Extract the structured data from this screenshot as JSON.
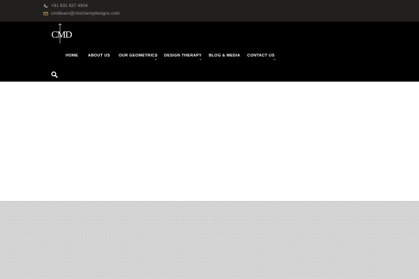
{
  "topbar": {
    "phone_icon": "phone-icon",
    "phone": "+91 931 837 4904",
    "email_icon": "envelope-icon",
    "email": "cmdteam@chizzlemydesigns.com"
  },
  "header": {
    "logo_text": "CMD",
    "nav": [
      {
        "label": "HOME",
        "has_dropdown": false
      },
      {
        "label": "ABOUT US",
        "has_dropdown": false
      },
      {
        "label": "OUR GEOMETRICS",
        "has_dropdown": true
      },
      {
        "label": "DESIGN THERAPY",
        "has_dropdown": true
      },
      {
        "label": "BLOG & MEDIA",
        "has_dropdown": false
      },
      {
        "label": "CONTACT US",
        "has_dropdown": true
      }
    ],
    "search_icon": "search-icon"
  },
  "colors": {
    "topbar_bg": "#221f1f",
    "header_bg": "#000000",
    "text_muted": "#9a9797",
    "grey_section": "#d4d4d4",
    "accent": "#c8a24a"
  }
}
